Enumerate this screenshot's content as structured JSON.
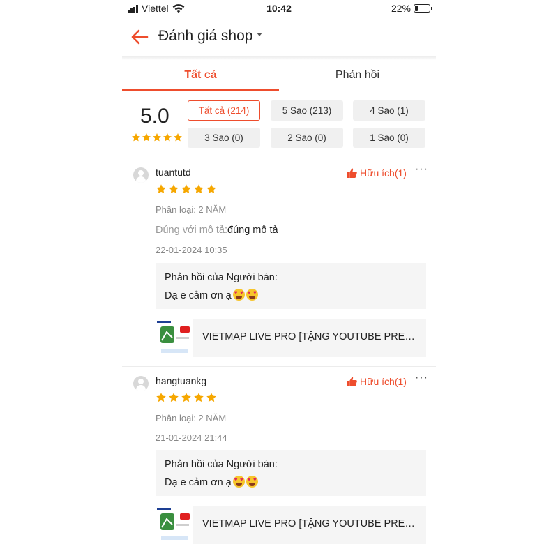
{
  "status_bar": {
    "carrier": "Viettel",
    "time": "10:42",
    "battery": "22%"
  },
  "header": {
    "title": "Đánh giá shop"
  },
  "tabs": [
    {
      "label": "Tất cả",
      "active": true
    },
    {
      "label": "Phản hồi",
      "active": false
    }
  ],
  "summary": {
    "score": "5.0",
    "stars": 5
  },
  "filters": [
    {
      "label": "Tất cả (214)",
      "active": true
    },
    {
      "label": "5 Sao (213)",
      "active": false
    },
    {
      "label": "4 Sao (1)",
      "active": false
    },
    {
      "label": "3 Sao (0)",
      "active": false
    },
    {
      "label": "2 Sao (0)",
      "active": false
    },
    {
      "label": "1 Sao (0)",
      "active": false
    }
  ],
  "reviews": [
    {
      "username": "tuantutd",
      "stars": 5,
      "helpful_label": "Hữu ích(1)",
      "variant": "Phân loại: 2 NĂM",
      "desc_label": "Đúng với mô tả:",
      "desc_value": "đúng mô tả",
      "date": "22-01-2024 10:35",
      "reply_heading": "Phản hồi của Người bán:",
      "reply_text": "Dạ e cảm ơn ạ",
      "product_name": "VIETMAP LIVE PRO [TẶNG YOUTUBE PREMIUM]"
    },
    {
      "username": "hangtuankg",
      "stars": 5,
      "helpful_label": "Hữu ích(1)",
      "variant": "Phân loại: 2 NĂM",
      "date": "21-01-2024 21:44",
      "reply_heading": "Phản hồi của Người bán:",
      "reply_text": "Dạ e cảm ơn ạ",
      "product_name": "VIETMAP LIVE PRO [TẶNG YOUTUBE PREMIUM]"
    }
  ],
  "colors": {
    "accent": "#ee4d2d",
    "star": "#f6a700",
    "chip_bg": "#f0f0f0",
    "reply_bg": "#f5f5f5"
  }
}
